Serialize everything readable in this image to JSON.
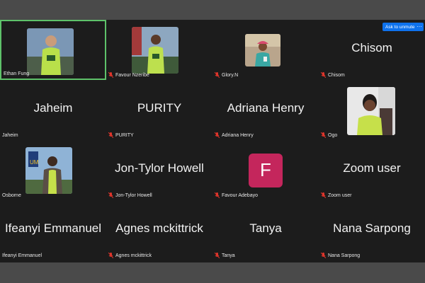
{
  "controls": {
    "unmute_label": "Ask to unmute",
    "more_glyph": "···"
  },
  "tiles": [
    {
      "label": "Ethan Fung",
      "muted": false,
      "active": true
    },
    {
      "label": "Favour Nzeribe",
      "muted": true
    },
    {
      "label": "Glory.N",
      "muted": true
    },
    {
      "label": "Chisom",
      "big_name": "Chisom",
      "muted": true
    },
    {
      "label": "Jaheim",
      "big_name": "Jaheim",
      "muted": false
    },
    {
      "label": "PURITY",
      "big_name": "PURITY",
      "muted": true
    },
    {
      "label": "Adriana Henry",
      "big_name": "Adriana Henry",
      "muted": true
    },
    {
      "label": "Ogo",
      "muted": true
    },
    {
      "label": "Osborne",
      "muted": false
    },
    {
      "label": "Jon-Tylor Howell",
      "big_name": "Jon-Tylor Howell",
      "muted": true
    },
    {
      "label": "Favour Adebayo",
      "avatar_letter": "F",
      "muted": true
    },
    {
      "label": "Zoom user",
      "big_name": "Zoom user",
      "muted": true
    },
    {
      "label": "Ifeanyi Emmanuel",
      "big_name": "Ifeanyi Emmanuel",
      "muted": false
    },
    {
      "label": "Agnes mckittrick",
      "big_name": "Agnes mckittrick",
      "muted": true
    },
    {
      "label": "Tanya",
      "big_name": "Tanya",
      "muted": true
    },
    {
      "label": "Nana Sarpong",
      "big_name": "Nana Sarpong",
      "muted": true
    }
  ],
  "colors": {
    "background": "#1c1c1c",
    "active_speaker_border": "#5ec26a",
    "muted_icon": "#e0352b",
    "avatar_bg": "#c4265c",
    "button_blue": "#0e72ed"
  }
}
